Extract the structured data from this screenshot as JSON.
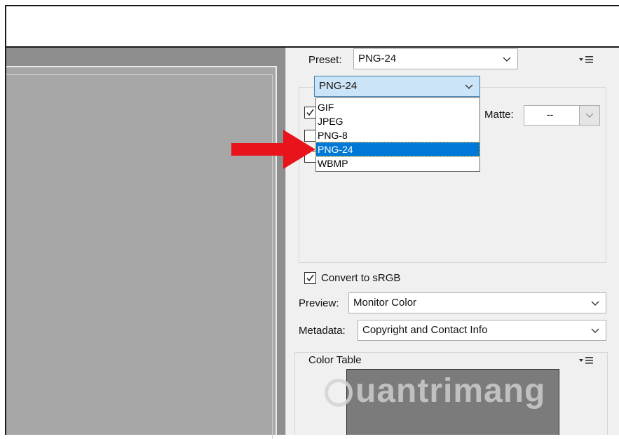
{
  "preset": {
    "label": "Preset:",
    "value": "PNG-24"
  },
  "format": {
    "value": "PNG-24",
    "options": [
      "GIF",
      "JPEG",
      "PNG-8",
      "PNG-24",
      "WBMP"
    ],
    "selected_index": 3
  },
  "matte": {
    "label": "Matte:",
    "value": "--"
  },
  "convert_srgb": {
    "label": "Convert to sRGB",
    "checked": true
  },
  "preview": {
    "label": "Preview:",
    "value": "Monitor Color"
  },
  "metadata": {
    "label": "Metadata:",
    "value": "Copyright and Contact Info"
  },
  "color_table": {
    "title": "Color Table"
  },
  "watermark": {
    "text": "uantrimang"
  },
  "icons": {
    "menu": "panel-menu-icon",
    "arrow": "red-arrow-icon",
    "chevron": "chevron-down-icon"
  },
  "colors": {
    "arrow": "#e8131b",
    "selection": "#0078d7",
    "accent": "#cce4f7"
  }
}
